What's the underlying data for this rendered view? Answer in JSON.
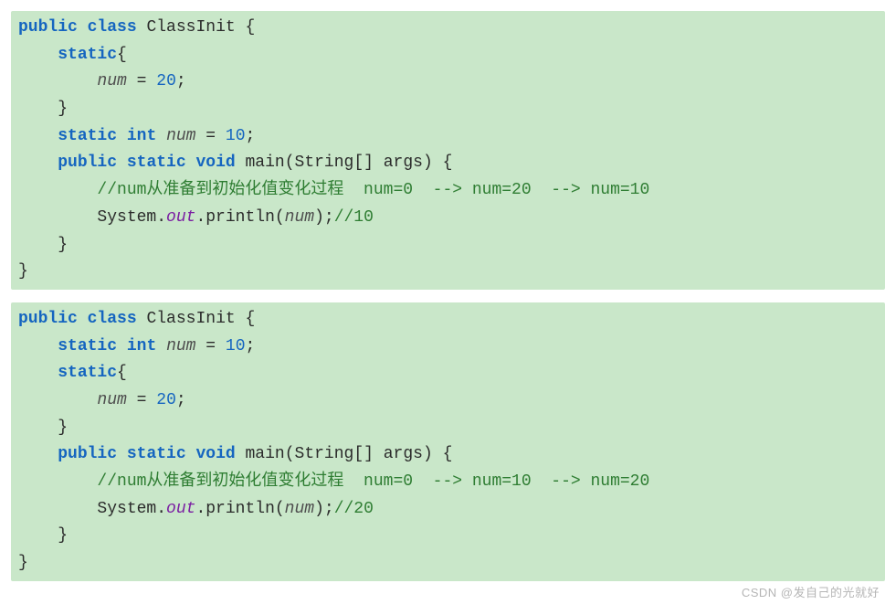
{
  "block1": {
    "t_public": "public",
    "t_class": "class",
    "t_classname": "ClassInit",
    "t_lbrace": "{",
    "t_static": "static",
    "t_lbrace2": "{",
    "t_num1": "num",
    "t_eq1": "=",
    "t_val20": "20",
    "t_semi1": ";",
    "t_rbrace1": "}",
    "t_static2": "static",
    "t_int": "int",
    "t_num2": "num",
    "t_eq2": "=",
    "t_val10": "10",
    "t_semi2": ";",
    "t_public2": "public",
    "t_static3": "static",
    "t_void": "void",
    "t_main": "main",
    "t_paren_args": "(String[] args)",
    "t_lbrace3": "{",
    "t_comment1": "//num从准备到初始化值变化过程  num=0  --> num=20  --> num=10",
    "t_sys": "System.",
    "t_out": "out",
    "t_println": ".println(",
    "t_num3": "num",
    "t_printend": ");",
    "t_comment2": "//10",
    "t_rbrace2": "}",
    "t_rbrace3": "}"
  },
  "block2": {
    "t_public": "public",
    "t_class": "class",
    "t_classname": "ClassInit",
    "t_lbrace": "{",
    "t_static2": "static",
    "t_int": "int",
    "t_num2": "num",
    "t_eq2": "=",
    "t_val10": "10",
    "t_semi2": ";",
    "t_static": "static",
    "t_lbrace2": "{",
    "t_num1": "num",
    "t_eq1": "=",
    "t_val20": "20",
    "t_semi1": ";",
    "t_rbrace1": "}",
    "t_public2": "public",
    "t_static3": "static",
    "t_void": "void",
    "t_main": "main",
    "t_paren_args": "(String[] args)",
    "t_lbrace3": "{",
    "t_comment1": "//num从准备到初始化值变化过程  num=0  --> num=10  --> num=20",
    "t_sys": "System.",
    "t_out": "out",
    "t_println": ".println(",
    "t_num3": "num",
    "t_printend": ");",
    "t_comment2": "//20",
    "t_rbrace2": "}",
    "t_rbrace3": "}"
  },
  "watermark": "CSDN @发自己的光就好"
}
